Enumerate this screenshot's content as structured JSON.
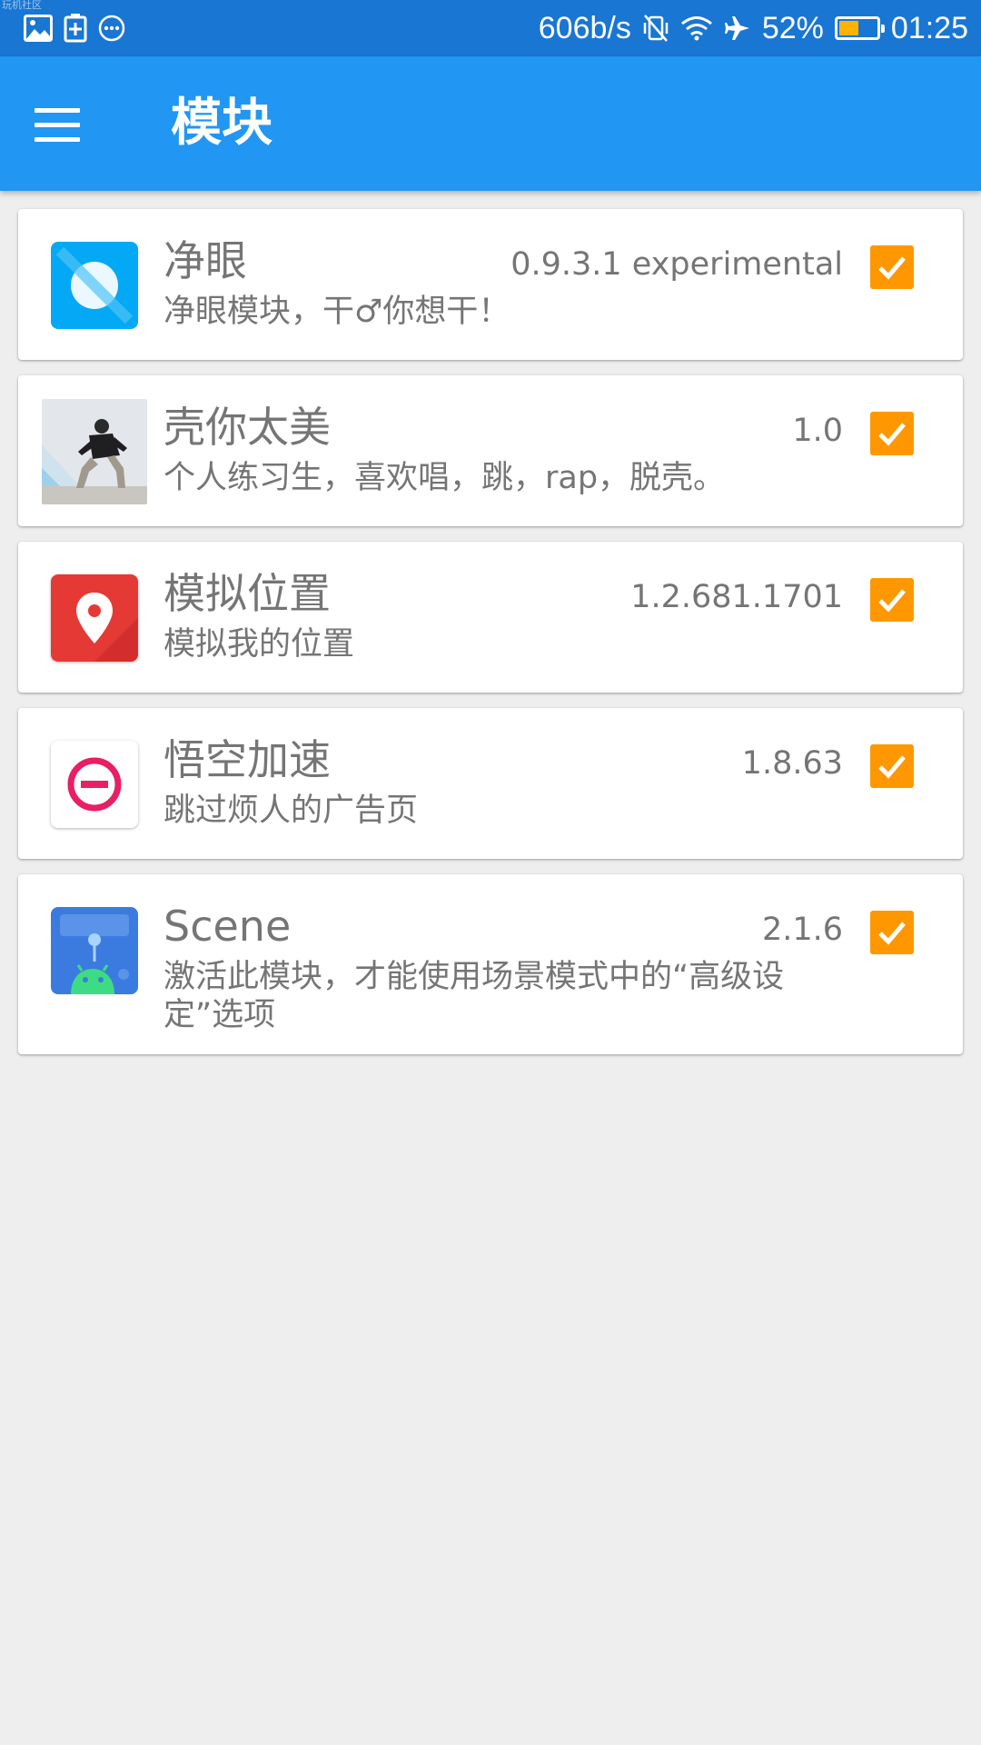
{
  "status_bar": {
    "watermark": "玩机社区",
    "network_speed": "606b/s",
    "battery_percent": "52%",
    "battery_level": 0.52,
    "time": "01:25",
    "icons": [
      "image-icon",
      "battery-saver-icon",
      "more-icon",
      "vibrate-off-icon",
      "wifi-icon",
      "airplane-mode-icon"
    ]
  },
  "app_bar": {
    "title": "模块",
    "color": "#2196f3",
    "menu_icon": "hamburger-menu-icon"
  },
  "modules": [
    {
      "name": "净眼",
      "version": "0.9.3.1 experimental",
      "description": "净眼模块，干♂你想干！",
      "checked": true,
      "icon": "jingyan-eye-icon"
    },
    {
      "name": "壳你太美",
      "version": "1.0",
      "description": "个人练习生，喜欢唱，跳，rap，脱壳。",
      "checked": true,
      "icon": "dancer-photo-icon"
    },
    {
      "name": "模拟位置",
      "version": "1.2.681.1701",
      "description": "模拟我的位置",
      "checked": true,
      "icon": "location-pin-icon"
    },
    {
      "name": "悟空加速",
      "version": "1.8.63",
      "description": "跳过烦人的广告页",
      "checked": true,
      "icon": "minus-circle-icon"
    },
    {
      "name": "Scene",
      "version": "2.1.6",
      "description": "激活此模块，才能使用场景模式中的“高级设定”选项",
      "checked": true,
      "icon": "scene-android-icon"
    }
  ],
  "colors": {
    "status_bar": "#1976d2",
    "checkbox": "#ff9800",
    "background": "#eeeeee",
    "text": "#757575"
  }
}
